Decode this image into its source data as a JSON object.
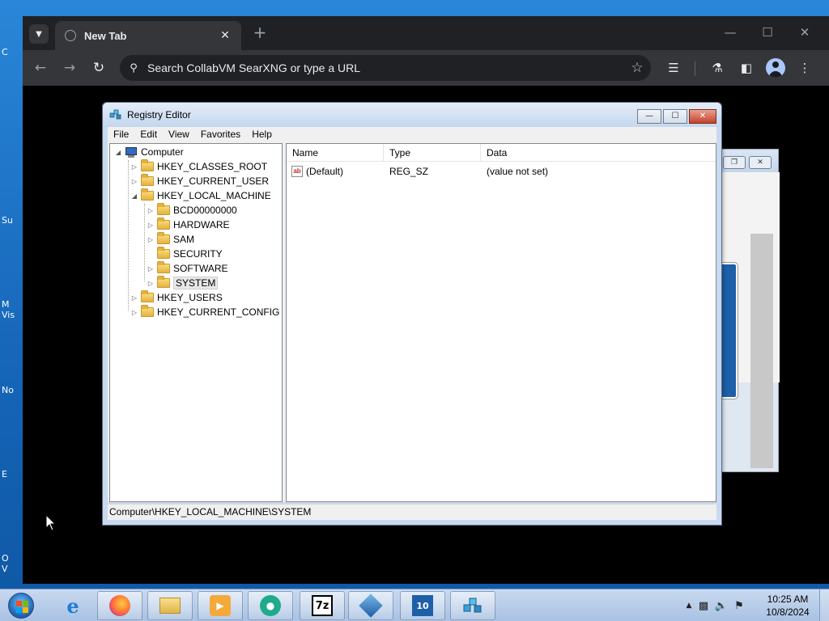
{
  "browser": {
    "tab_title": "New Tab",
    "omnibox_placeholder": "Search CollabVM SearXNG or type a URL"
  },
  "regedit": {
    "title": "Registry Editor",
    "menu": [
      "File",
      "Edit",
      "View",
      "Favorites",
      "Help"
    ],
    "tree": {
      "root": "Computer",
      "hives": [
        "HKEY_CLASSES_ROOT",
        "HKEY_CURRENT_USER",
        "HKEY_LOCAL_MACHINE"
      ],
      "hklm_children": [
        "BCD00000000",
        "HARDWARE",
        "SAM",
        "SECURITY",
        "SOFTWARE",
        "SYSTEM"
      ],
      "hives_after": [
        "HKEY_USERS",
        "HKEY_CURRENT_CONFIG"
      ],
      "selected": "SYSTEM"
    },
    "columns": [
      "Name",
      "Type",
      "Data"
    ],
    "values": [
      {
        "name": "(Default)",
        "type": "REG_SZ",
        "data": "(value not set)",
        "icon": "string-value-icon"
      }
    ],
    "status_path": "Computer\\HKEY_LOCAL_MACHINE\\SYSTEM"
  },
  "taskbar": {
    "time": "10:25 AM",
    "date": "10/8/2024",
    "apps": [
      "start-orb",
      "internet-explorer-icon",
      "firefox-icon",
      "file-explorer-icon",
      "media-player-icon",
      "chat-app-icon",
      "7zip-icon",
      "virtualbox-icon",
      "win10-installer-icon",
      "registry-editor-icon"
    ]
  },
  "colors": {
    "chrome_dark": "#202124",
    "chrome_toolbar": "#35363a",
    "aero_title": "#c4d7ee",
    "taskbar": "#a9c2e3"
  }
}
